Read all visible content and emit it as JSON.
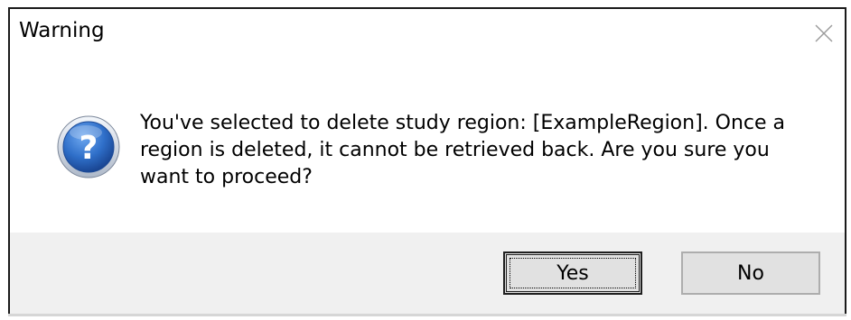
{
  "dialog": {
    "title": "Warning",
    "icon": "question-icon",
    "message": "You've selected to delete study region: [ExampleRegion]. Once a region is deleted, it cannot be retrieved back. Are you sure you want to proceed?",
    "buttons": {
      "yes_label": "Yes",
      "no_label": "No"
    },
    "close_icon": "close-icon"
  },
  "colors": {
    "footer_background": "#f0f0f0",
    "button_background": "#e1e1e1",
    "icon_blue": "#2f6fc9"
  }
}
